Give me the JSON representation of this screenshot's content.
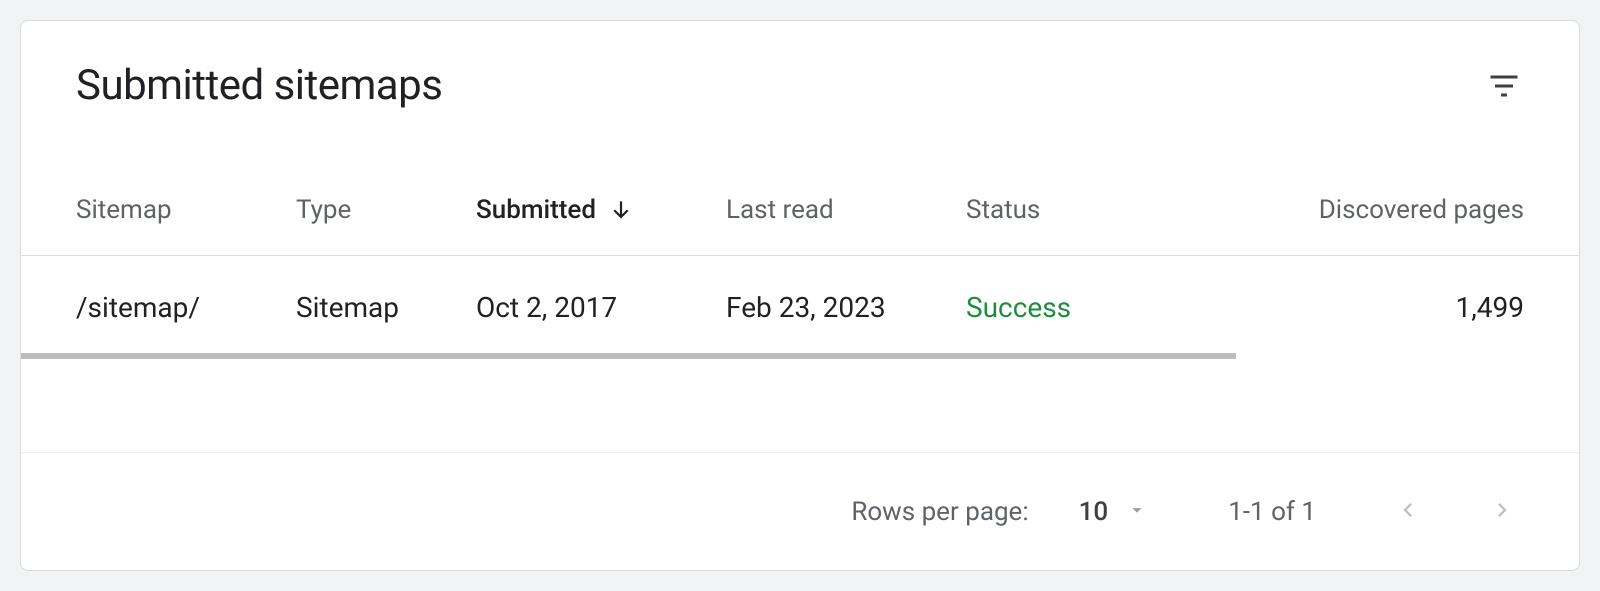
{
  "card": {
    "title": "Submitted sitemaps"
  },
  "table": {
    "headers": {
      "sitemap": "Sitemap",
      "type": "Type",
      "submitted": "Submitted",
      "last_read": "Last read",
      "status": "Status",
      "discovered": "Discovered pages"
    },
    "sorted_column": "submitted",
    "sort_direction": "desc",
    "rows": [
      {
        "sitemap": "/sitemap/",
        "type": "Sitemap",
        "submitted": "Oct 2, 2017",
        "last_read": "Feb 23, 2023",
        "status": "Success",
        "status_color": "#1e8e3e",
        "discovered": "1,499"
      }
    ]
  },
  "pagination": {
    "rows_label": "Rows per page:",
    "rows_value": "10",
    "page_info": "1-1 of 1"
  }
}
